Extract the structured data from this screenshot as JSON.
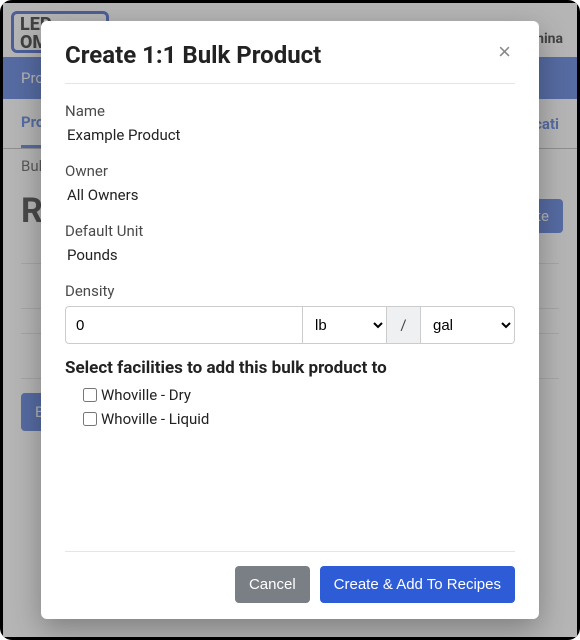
{
  "background": {
    "logo_line1": "LEP",
    "logo_line2": "OM",
    "topright": "Termina",
    "mainnav_item": "Prod",
    "subnav_left": "Pro",
    "subnav_right": "locati",
    "crumb": "Bulk",
    "heading": "Re",
    "create_btn": "eate",
    "chip": "Ba"
  },
  "modal": {
    "title": "Create 1:1 Bulk Product",
    "close": "×",
    "fields": {
      "name_label": "Name",
      "name_value": "Example Product",
      "owner_label": "Owner",
      "owner_value": "All Owners",
      "unit_label": "Default Unit",
      "unit_value": "Pounds",
      "density_label": "Density",
      "density_value": "0",
      "density_mass": "lb",
      "density_sep": "/",
      "density_vol": "gal"
    },
    "facilities": {
      "title": "Select facilities to add this bulk product to",
      "items": [
        {
          "label": "Whoville - Dry"
        },
        {
          "label": "Whoville - Liquid"
        }
      ]
    },
    "buttons": {
      "cancel": "Cancel",
      "submit": "Create & Add To Recipes"
    }
  }
}
